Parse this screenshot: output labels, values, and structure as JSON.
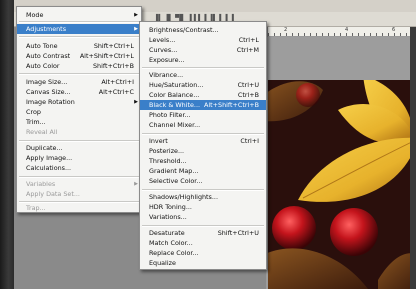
{
  "toolbar": {
    "icons": "▐▌ █ ▀█ ▐▐▐ ▌▐▌▐ ▌▐"
  },
  "ruler": {
    "marks": [
      "2",
      "4",
      "6"
    ]
  },
  "image_menu": {
    "items": [
      {
        "label": "Mode",
        "submenu": true
      },
      {
        "label": "Adjustments",
        "submenu": true,
        "highlighted": true
      },
      {
        "label": "Auto Tone",
        "shortcut": "Shift+Ctrl+L"
      },
      {
        "label": "Auto Contrast",
        "shortcut": "Alt+Shift+Ctrl+L"
      },
      {
        "label": "Auto Color",
        "shortcut": "Shift+Ctrl+B"
      },
      {
        "label": "Image Size...",
        "shortcut": "Alt+Ctrl+I"
      },
      {
        "label": "Canvas Size...",
        "shortcut": "Alt+Ctrl+C"
      },
      {
        "label": "Image Rotation",
        "submenu": true
      },
      {
        "label": "Crop"
      },
      {
        "label": "Trim..."
      },
      {
        "label": "Reveal All",
        "disabled": true
      },
      {
        "label": "Duplicate..."
      },
      {
        "label": "Apply Image..."
      },
      {
        "label": "Calculations..."
      },
      {
        "label": "Variables",
        "submenu": true,
        "disabled": true
      },
      {
        "label": "Apply Data Set...",
        "disabled": true
      },
      {
        "label": "Trap...",
        "disabled": true
      }
    ]
  },
  "adjustments_menu": {
    "items": [
      {
        "label": "Brightness/Contrast..."
      },
      {
        "label": "Levels...",
        "shortcut": "Ctrl+L"
      },
      {
        "label": "Curves...",
        "shortcut": "Ctrl+M"
      },
      {
        "label": "Exposure..."
      },
      {
        "label": "Vibrance..."
      },
      {
        "label": "Hue/Saturation...",
        "shortcut": "Ctrl+U"
      },
      {
        "label": "Color Balance...",
        "shortcut": "Ctrl+B"
      },
      {
        "label": "Black & White...",
        "shortcut": "Alt+Shift+Ctrl+B",
        "highlighted": true
      },
      {
        "label": "Photo Filter..."
      },
      {
        "label": "Channel Mixer..."
      },
      {
        "label": "Invert",
        "shortcut": "Ctrl+I"
      },
      {
        "label": "Posterize..."
      },
      {
        "label": "Threshold..."
      },
      {
        "label": "Gradient Map..."
      },
      {
        "label": "Selective Color..."
      },
      {
        "label": "Shadows/Highlights..."
      },
      {
        "label": "HDR Toning..."
      },
      {
        "label": "Variations..."
      },
      {
        "label": "Desaturate",
        "shortcut": "Shift+Ctrl+U"
      },
      {
        "label": "Match Color..."
      },
      {
        "label": "Replace Color..."
      },
      {
        "label": "Equalize"
      }
    ]
  },
  "colors": {
    "highlight": "#3a7fc9",
    "leaf": "#e7b22c",
    "berry": "#c4141c"
  }
}
